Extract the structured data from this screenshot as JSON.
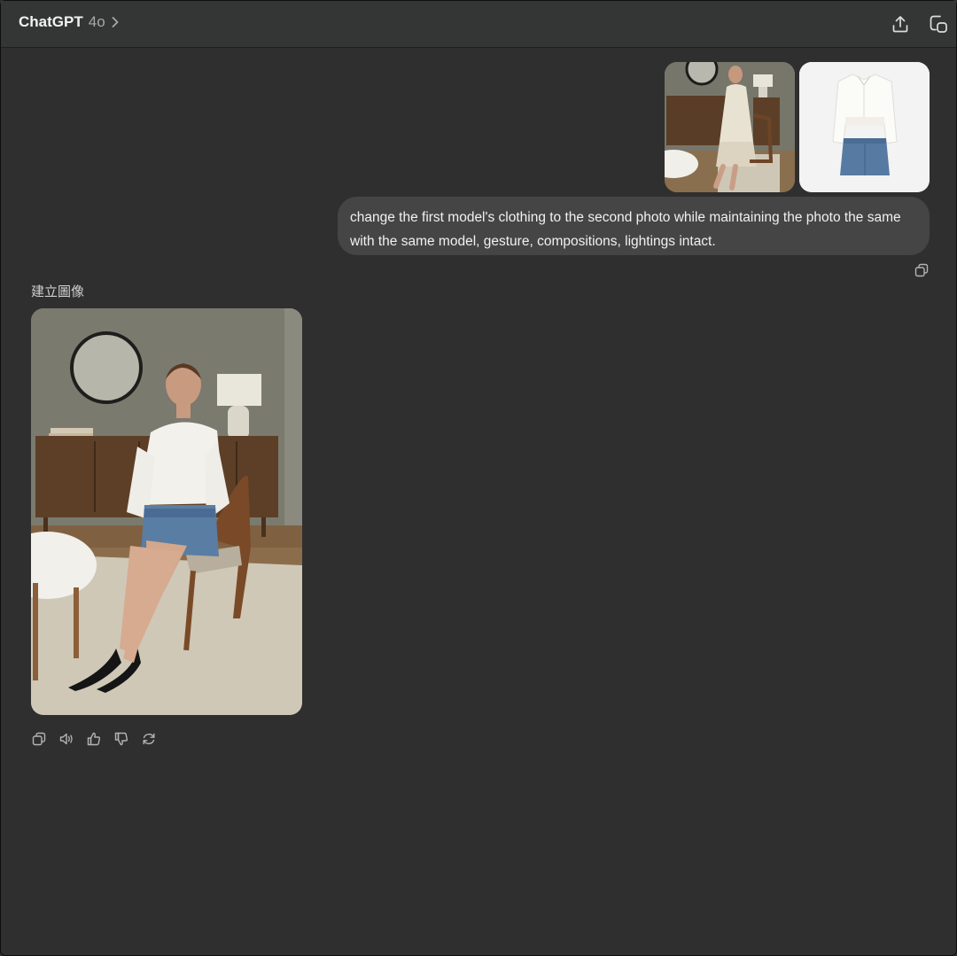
{
  "header": {
    "app_title": "ChatGPT",
    "model_version": "4o",
    "icons": [
      "chevron-right-icon",
      "share-icon",
      "new-chat-icon"
    ]
  },
  "user_message": {
    "attachments": [
      {
        "label": "model-photo"
      },
      {
        "label": "clothing-photo"
      }
    ],
    "text": "change the first model's clothing to the second photo while maintaining the photo the same with the same model, gesture, compositions, lightings intact."
  },
  "assistant_message": {
    "label": "建立圖像",
    "action_icons": [
      "copy-icon",
      "read-aloud-icon",
      "thumbs-up-icon",
      "thumbs-down-icon",
      "regenerate-icon"
    ]
  },
  "colors": {
    "background": "#2f2f2f",
    "header": "#343535",
    "bubble": "#454545",
    "text": "#ececec"
  }
}
